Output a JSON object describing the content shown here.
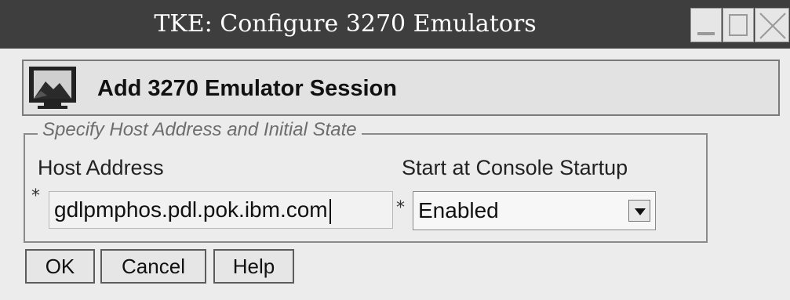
{
  "window": {
    "title": "TKE: Configure 3270 Emulators",
    "controls": [
      "minimize-icon",
      "maximize-icon",
      "close-icon"
    ]
  },
  "header": {
    "title": "Add 3270 Emulator Session",
    "icon": "monitor-icon"
  },
  "group": {
    "legend": "Specify Host Address and Initial State",
    "host_address": {
      "label": "Host Address",
      "required_marker": "*",
      "value": "gdlpmphos.pdl.pok.ibm.com"
    },
    "start_at_console_startup": {
      "label": "Start at Console Startup",
      "required_marker": "*",
      "selected": "Enabled"
    }
  },
  "buttons": {
    "ok": "OK",
    "cancel": "Cancel",
    "help": "Help"
  }
}
